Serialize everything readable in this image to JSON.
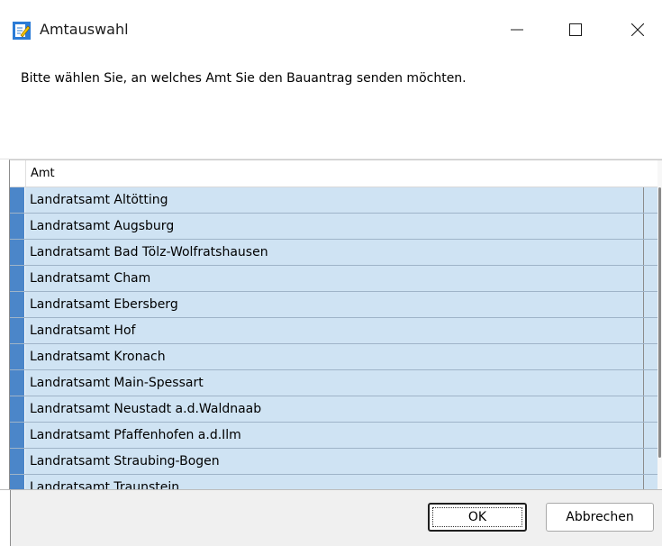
{
  "window": {
    "title": "Amtauswahl",
    "icon": "edit-document-icon",
    "controls": [
      "minimize-icon",
      "maximize-icon",
      "close-icon"
    ]
  },
  "message": "Bitte wählen Sie, an welches Amt Sie den Bauantrag senden möchten.",
  "table": {
    "column_header": "Amt",
    "rows": [
      "Landratsamt Altötting",
      "Landratsamt Augsburg",
      "Landratsamt Bad Tölz-Wolfratshausen",
      "Landratsamt Cham",
      "Landratsamt Ebersberg",
      "Landratsamt Hof",
      "Landratsamt Kronach",
      "Landratsamt Main-Spessart",
      "Landratsamt Neustadt a.d.Waldnaab",
      "Landratsamt Pfaffenhofen a.d.Ilm",
      "Landratsamt Straubing-Bogen",
      "Landratsamt Traunstein"
    ]
  },
  "buttons": {
    "ok": "OK",
    "cancel": "Abbrechen"
  },
  "colors": {
    "row_background": "#cfe3f3",
    "row_indicator": "#4b86c9"
  }
}
